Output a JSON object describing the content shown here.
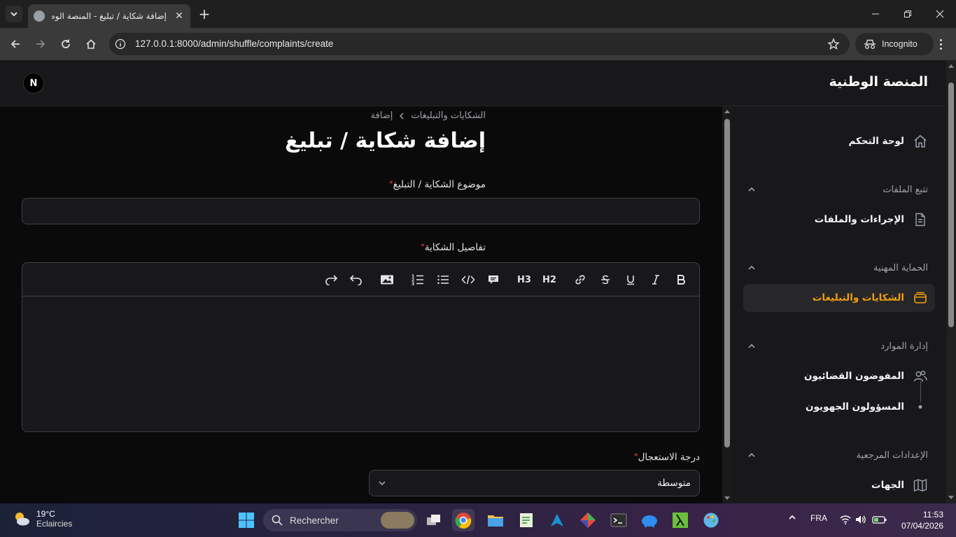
{
  "browser": {
    "tab_title": "إضافة شكاية / تبليغ - المنصة الوطنية",
    "url": "127.0.0.1:8000/admin/shuffle/complaints/create",
    "incognito_label": "Incognito"
  },
  "app": {
    "brand": "المنصة الوطنية",
    "avatar_initial": "N"
  },
  "sidebar": {
    "dashboard": "لوحة التحكم",
    "groups": [
      {
        "label": "تتبع الملفات",
        "items": [
          {
            "label": "الإجراءات والملفات",
            "icon": "document-icon"
          }
        ]
      },
      {
        "label": "الحماية المهنية",
        "items": [
          {
            "label": "الشكايات والتبليغات",
            "icon": "inbox-icon",
            "active": true
          }
        ]
      },
      {
        "label": "إدارة الموارد",
        "items": [
          {
            "label": "المفوضون القضائيون",
            "icon": "users-icon"
          },
          {
            "label": "المسؤولون الجهويون",
            "icon": "dot-icon"
          }
        ]
      },
      {
        "label": "الإعدادات المرجعية",
        "items": [
          {
            "label": "الجهات",
            "icon": "map-icon"
          }
        ]
      }
    ],
    "accent_color": "#f59e0b"
  },
  "main": {
    "breadcrumb": [
      "الشكايات والتبليغات",
      "إضافة"
    ],
    "page_title": "إضافة شكاية / تبليغ",
    "fields": {
      "subject_label": "موضوع الشكاية / التبليغ",
      "subject_value": "",
      "details_label": "تفاصيل الشكاية",
      "urgency_label": "درجة الاستعجال",
      "urgency_value": "متوسطة"
    },
    "required_marker": "*",
    "editor_buttons": [
      "bold",
      "italic",
      "underline",
      "strike",
      "link",
      "h2",
      "h3",
      "blockquote",
      "code-block",
      "bullet-list",
      "ordered-list",
      "attach-files",
      "undo",
      "redo"
    ],
    "h2_label": "H2",
    "h3_label": "H3"
  },
  "taskbar": {
    "temperature": "19°C",
    "weather": "Eclaircies",
    "search_label": "Rechercher",
    "lang": "FRA",
    "time": "11:53",
    "date": "07/04/2026"
  }
}
